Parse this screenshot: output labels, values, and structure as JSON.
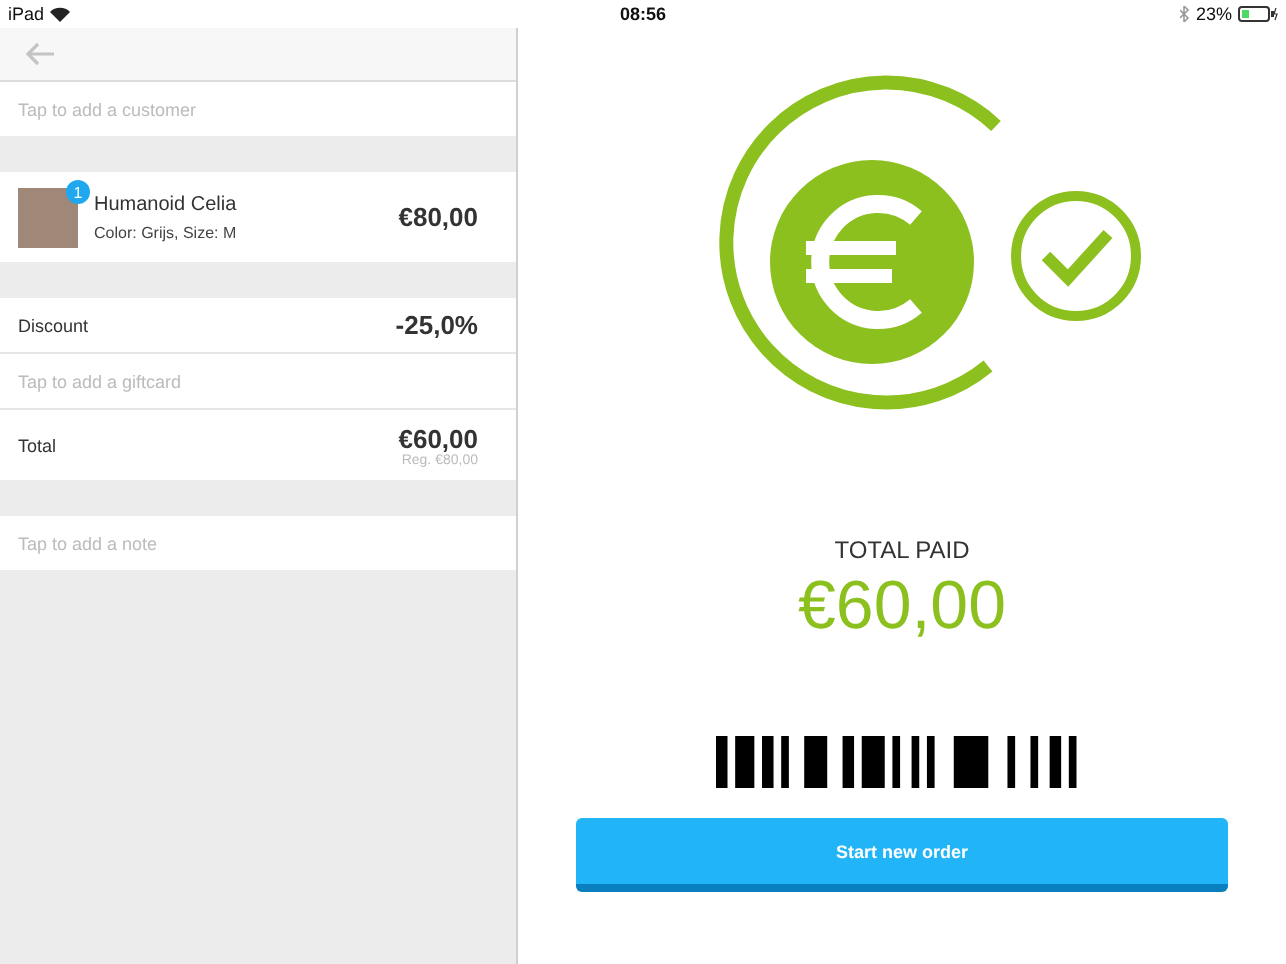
{
  "status_bar": {
    "device": "iPad",
    "time": "08:56",
    "battery": "23%"
  },
  "order": {
    "customer_placeholder": "Tap to add a customer",
    "items": [
      {
        "name": "Humanoid Celia",
        "variant": "Color: Grijs, Size: M",
        "price": "€80,00",
        "quantity": "1"
      }
    ],
    "discount": {
      "label": "Discount",
      "value": "-25,0%"
    },
    "giftcard_placeholder": "Tap to add a giftcard",
    "total": {
      "label": "Total",
      "value": "€60,00",
      "regular": "Reg. €80,00"
    },
    "note_placeholder": "Tap to add a note"
  },
  "payment": {
    "label": "TOTAL PAID",
    "amount": "€60,00",
    "button": "Start new order"
  }
}
